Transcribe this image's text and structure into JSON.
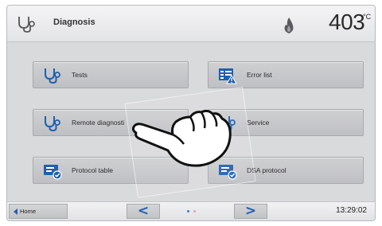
{
  "header": {
    "title": "Diagnosis",
    "icon": "stethoscope-icon",
    "flame_icon": "flame-icon",
    "temperature": "403",
    "temperature_unit": "°C"
  },
  "tiles": [
    {
      "id": "tests",
      "label": "Tests",
      "icon": "stethoscope-icon"
    },
    {
      "id": "error_list",
      "label": "Error list",
      "icon": "error-list-icon"
    },
    {
      "id": "remote",
      "label": "Remote diagnosti",
      "icon": "stethoscope-icon"
    },
    {
      "id": "service",
      "label": "Service",
      "icon": "stethoscope-icon"
    },
    {
      "id": "protocol",
      "label": "Protocol table",
      "icon": "protocol-icon"
    },
    {
      "id": "dsa",
      "label": "DSA protocol",
      "icon": "protocol-icon"
    }
  ],
  "overlay": {
    "icon": "pointing-hand-icon"
  },
  "footer": {
    "home_label": "Home",
    "prev_symbol": "<",
    "next_symbol": ">",
    "page_index": 1,
    "page_count": 2,
    "time": "13:29:02"
  },
  "colors": {
    "accent_blue": "#1f5fb0",
    "panel_gray": "#d9dadc",
    "tile_gray": "#c7c8cb"
  }
}
